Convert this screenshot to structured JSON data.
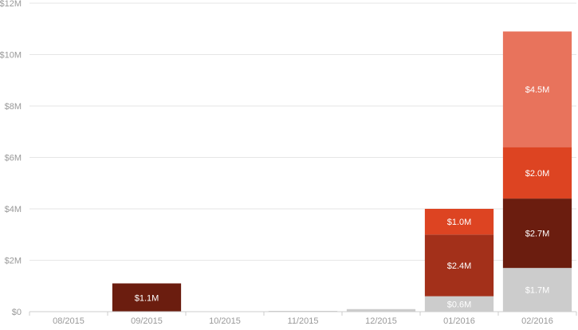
{
  "chart_data": {
    "type": "bar",
    "stacked": true,
    "title": "",
    "xlabel": "",
    "ylabel": "",
    "ylim": [
      0,
      12000000
    ],
    "y_ticks": [
      0,
      2000000,
      4000000,
      6000000,
      8000000,
      10000000,
      12000000
    ],
    "y_tick_labels": [
      "$0",
      "$2M",
      "$4M",
      "$6M",
      "$8M",
      "$10M",
      "$12M"
    ],
    "grid": true,
    "legend": "none",
    "categories": [
      "08/2015",
      "09/2015",
      "10/2015",
      "11/2015",
      "12/2015",
      "01/2016",
      "02/2016"
    ],
    "series": [
      {
        "color": "#cccccc",
        "values": [
          0,
          0,
          0,
          30000,
          100000,
          600000,
          1700000
        ],
        "labels": [
          "",
          "",
          "",
          "",
          "",
          "$0.6M",
          "$1.7M"
        ]
      },
      {
        "color": "#6b1d0f",
        "values": [
          0,
          1100000,
          0,
          0,
          0,
          0,
          2700000
        ],
        "labels": [
          "",
          "$1.1M",
          "",
          "",
          "",
          "",
          "$2.7M"
        ]
      },
      {
        "color": "#a3301a",
        "values": [
          0,
          0,
          0,
          0,
          0,
          2400000,
          0
        ],
        "labels": [
          "",
          "",
          "",
          "",
          "",
          "$2.4M",
          ""
        ]
      },
      {
        "color": "#dd4422",
        "values": [
          0,
          0,
          0,
          0,
          0,
          1000000,
          2000000
        ],
        "labels": [
          "",
          "",
          "",
          "",
          "",
          "$1.0M",
          "$2.0M"
        ]
      },
      {
        "color": "#e8735c",
        "values": [
          0,
          0,
          0,
          0,
          0,
          0,
          4500000
        ],
        "labels": [
          "",
          "",
          "",
          "",
          "",
          "",
          "$4.5M"
        ]
      }
    ],
    "colors": {
      "gridline": "#e6e6e6",
      "axis": "#cccccc",
      "tick_text": "#999999",
      "bar_label": "#ffffff"
    }
  }
}
